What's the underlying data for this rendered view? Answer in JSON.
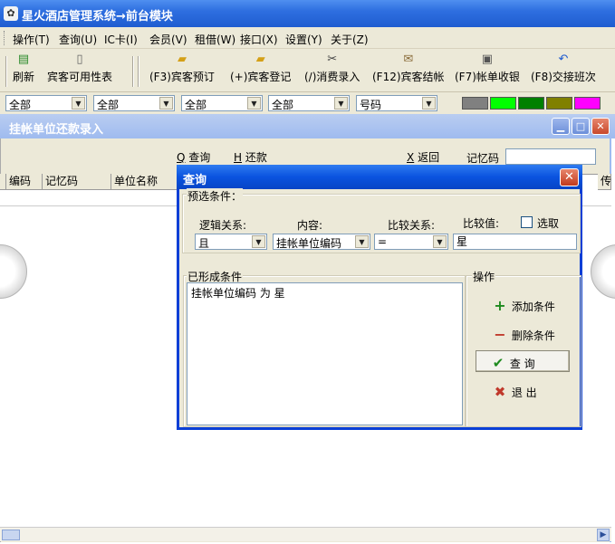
{
  "window": {
    "title": "星火酒店管理系统→前台模块",
    "app_icon": "palette-icon"
  },
  "menu": [
    {
      "label": "操作(T)"
    },
    {
      "label": "查询(U)"
    },
    {
      "label": "IC卡(I)"
    },
    {
      "label": "会员(V)"
    },
    {
      "label": "租借(W)"
    },
    {
      "label": "接口(X)"
    },
    {
      "label": "设置(Y)"
    },
    {
      "label": "关于(Z)"
    }
  ],
  "toolbar": [
    {
      "label": "刷新",
      "icon": "refresh-icon"
    },
    {
      "label": "宾客可用性表",
      "icon": "document-icon"
    },
    {
      "label": "(F3)宾客预订",
      "icon": "folder-open-icon"
    },
    {
      "label": "(+)宾客登记",
      "icon": "folder-star-icon"
    },
    {
      "label": "(/)消费录入",
      "icon": "scissors-icon"
    },
    {
      "label": "(F12)宾客结帐",
      "icon": "envelope-icon"
    },
    {
      "label": "(F7)帐单收银",
      "icon": "printer-icon"
    },
    {
      "label": "(F8)交接班次",
      "icon": "undo-arrow-icon"
    }
  ],
  "filters": [
    {
      "value": "全部"
    },
    {
      "value": "全部"
    },
    {
      "value": "全部"
    },
    {
      "value": "全部"
    },
    {
      "value": "号码"
    }
  ],
  "swatches": [
    "#808080",
    "#00ff00",
    "#008000",
    "#808000",
    "#ff00ff"
  ],
  "child_window": {
    "title": "挂帐单位还款录入",
    "actions": {
      "query_key": "Q",
      "query_label": "查询",
      "repay_key": "H",
      "repay_label": "还款",
      "return_key": "X",
      "return_label": "返回",
      "memo_label": "记忆码",
      "memo_value": ""
    },
    "columns": [
      "编码",
      "记忆码",
      "单位名称"
    ],
    "right_column": "传"
  },
  "dialog": {
    "title": "查询",
    "preset_group": "预选条件：",
    "logic_label": "逻辑关系:",
    "content_label": "内容:",
    "compare_label": "比较关系:",
    "value_label": "比较值:",
    "checkbox_label": "选取",
    "checkbox_checked": false,
    "logic_value": "且",
    "content_value": "挂帐单位编码",
    "compare_value": "=",
    "compare_input": "星",
    "formed_group": "已形成条件",
    "formed_conditions": [
      "挂帐单位编码 为 星"
    ],
    "ops_group": "操作",
    "btn_add": "添加条件",
    "btn_delete": "删除条件",
    "btn_query": "查  询",
    "btn_exit": "退  出"
  }
}
